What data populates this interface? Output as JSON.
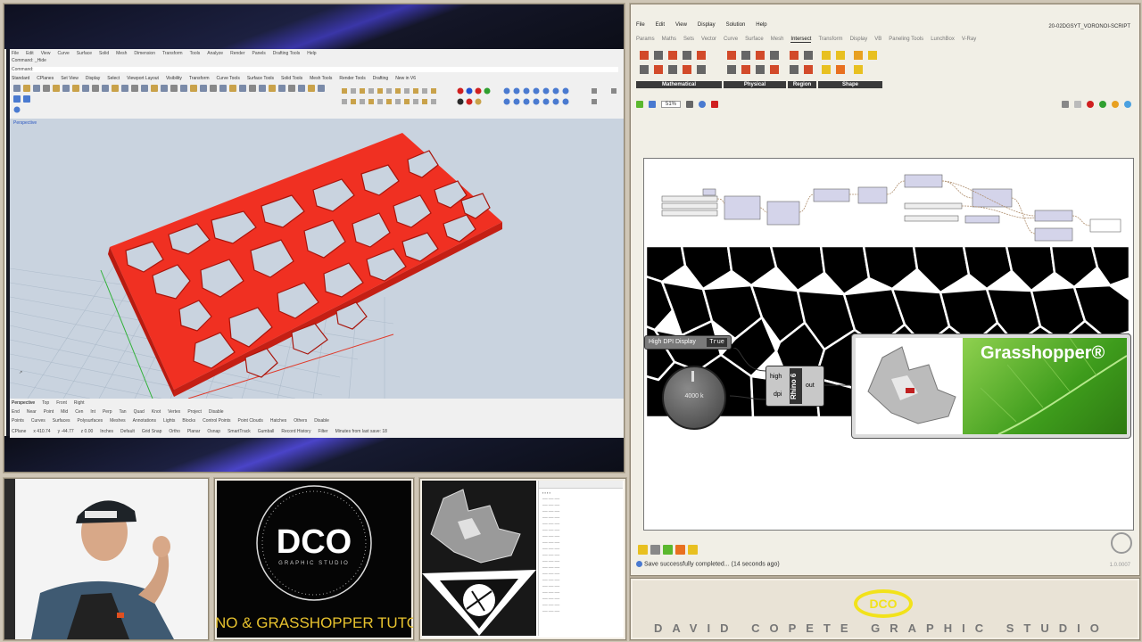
{
  "rhino": {
    "menu": [
      "File",
      "Edit",
      "View",
      "Curve",
      "Surface",
      "Solid",
      "Mesh",
      "Dimension",
      "Transform",
      "Tools",
      "Analyze",
      "Render",
      "Panels",
      "Drafting Tools",
      "Help"
    ],
    "command_label": "Command: _Hide",
    "command_prompt": "Command:",
    "toolbar_tabs": [
      "Standard",
      "CPlanes",
      "Set View",
      "Display",
      "Select",
      "Viewport Layout",
      "Visibility",
      "Transform",
      "Curve Tools",
      "Surface Tools",
      "Solid Tools",
      "Mesh Tools",
      "Render Tools",
      "Drafting",
      "New in V6"
    ],
    "viewport_label": "Perspective",
    "viewport_tabs": [
      "Perspective",
      "Top",
      "Front",
      "Right"
    ],
    "osnaps": [
      "End",
      "Near",
      "Point",
      "Mid",
      "Cen",
      "Int",
      "Perp",
      "Tan",
      "Quad",
      "Knot",
      "Vertex",
      "Project",
      "Disable"
    ],
    "select_filters": [
      "Points",
      "Curves",
      "Surfaces",
      "Polysurfaces",
      "Meshes",
      "Annotations",
      "Lights",
      "Blocks",
      "Control Points",
      "Point Clouds",
      "Hatches",
      "Others",
      "Disable"
    ],
    "status": {
      "cplane": "CPlane",
      "x": "x 410.74",
      "y": "y -44.77",
      "z": "z 0.00",
      "units": "Inches",
      "layer": "Default",
      "grid_snap": "Grid Snap",
      "ortho": "Ortho",
      "planar": "Planar",
      "osnap": "Osnap",
      "smarttrack": "SmartTrack",
      "gumball": "Gumball",
      "record_history": "Record History",
      "filter": "Filter",
      "last_save": "Minutes from last save: 18"
    }
  },
  "grasshopper": {
    "menu": [
      "File",
      "Edit",
      "View",
      "Display",
      "Solution",
      "Help"
    ],
    "document_title": "20-02DGSYT_VORONOI-SCRIPT",
    "tabs": [
      "Params",
      "Maths",
      "Sets",
      "Vector",
      "Curve",
      "Surface",
      "Mesh",
      "Intersect",
      "Transform",
      "Display",
      "VB",
      "Paneling Tools",
      "LunchBox",
      "V-Ray"
    ],
    "active_tab": "Intersect",
    "groups": [
      "Mathematical",
      "Physical",
      "Region",
      "Shape"
    ],
    "zoom": "51%",
    "high_dpi_label": "High DPI Display",
    "high_dpi_value": "True",
    "slider_value": "4000 k",
    "component_inputs": [
      "high",
      "dpi"
    ],
    "component_name": "Rhino 6",
    "component_output": "out",
    "grasshopper_logo_text": "Grasshopper®",
    "status_message": "Save successfully completed... (14 seconds ago)",
    "version": "1.0.0007"
  },
  "branding": {
    "dco_letters": "DCO",
    "dco_sub": "GRAPHIC STUDIO",
    "tutorial_text": "NO & GRASSHOPPER TUTO",
    "studio_name": "DAVID COPETE GRAPHIC STUDIO"
  },
  "colors": {
    "voronoi_red": "#f03022",
    "grass_green": "#5bb82e",
    "dco_gold": "#e7c22e"
  }
}
